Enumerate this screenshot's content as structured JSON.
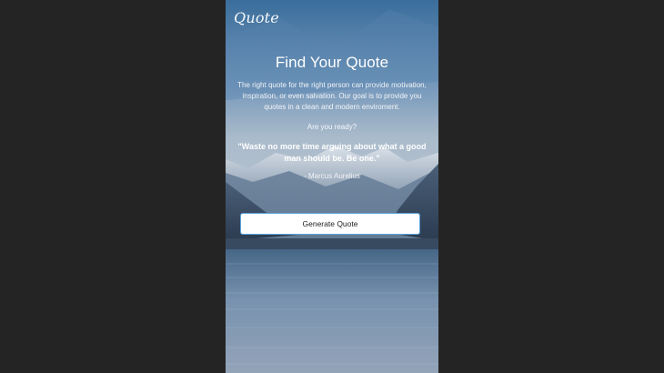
{
  "app": {
    "logo_text": "Quote"
  },
  "hero": {
    "title": "Find Your Quote",
    "description": "The right quote for the right person can provide motivation, inspiration, or even salvation. Our goal is to provide you quotes in a clean and modern enviroment.",
    "prompt": "Are you ready?"
  },
  "quote": {
    "text": "\"Waste no more time arguing about what a good man should be. Be one.\"",
    "author": "- Marcus Aurelius"
  },
  "actions": {
    "generate_label": "Generate Quote"
  },
  "colors": {
    "page_background": "#242424",
    "button_border": "#5aa3d9",
    "text": "#ffffff"
  }
}
